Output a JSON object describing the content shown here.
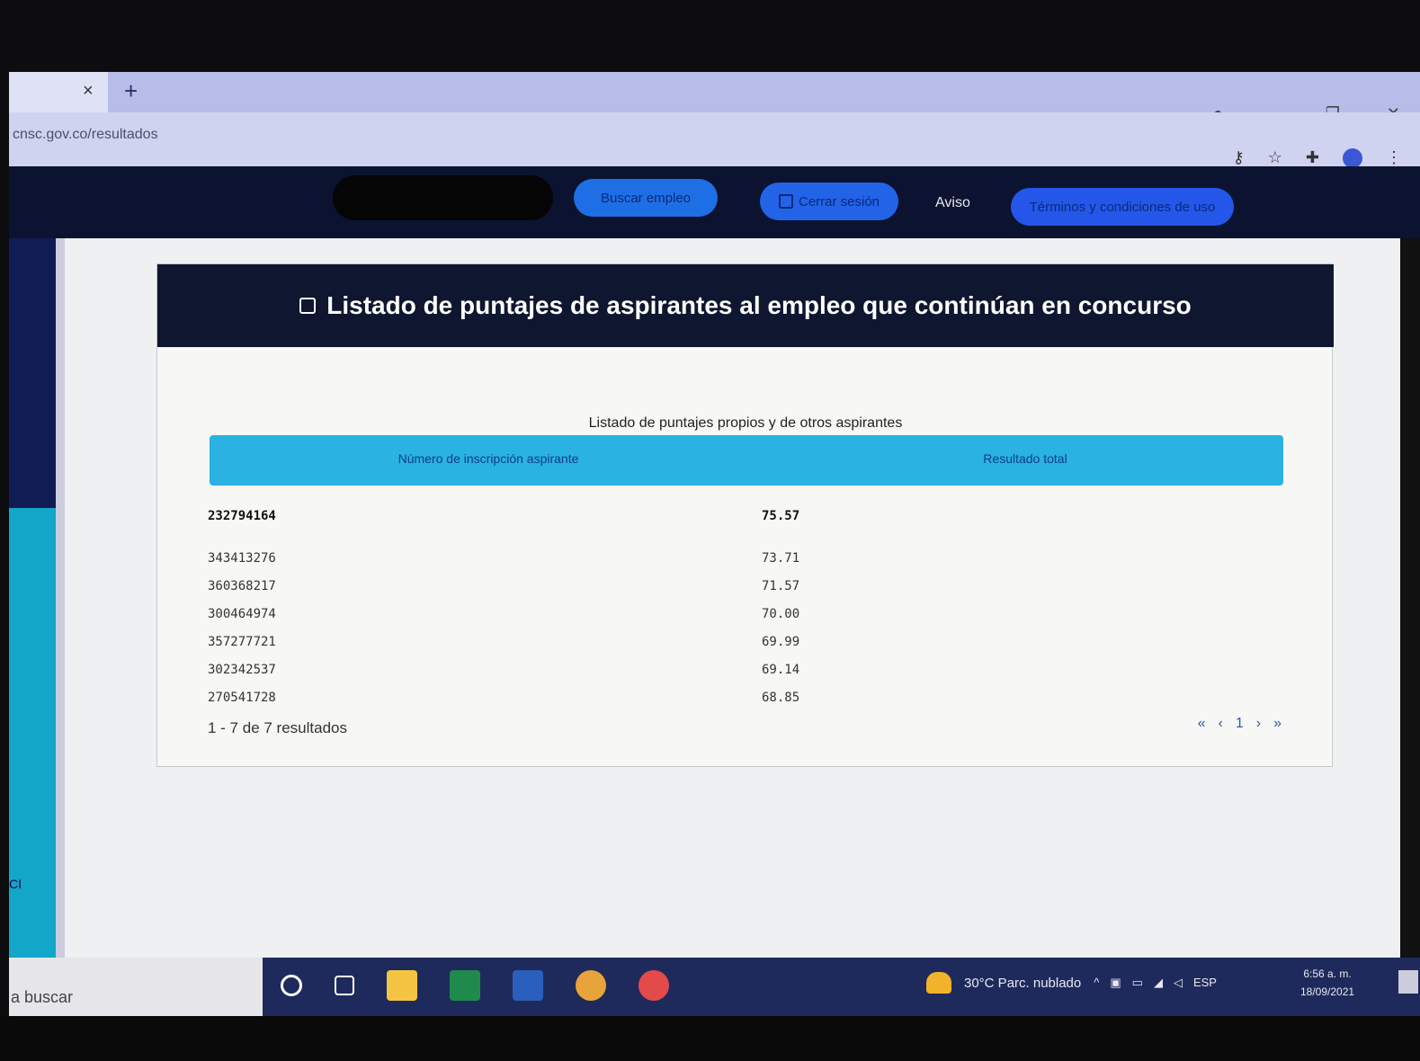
{
  "browser": {
    "url": "cnsc.gov.co/resultados",
    "tab_close": "×",
    "new_tab": "+"
  },
  "nav": {
    "buscar_empleo": "Buscar empleo",
    "cerrar_sesion": "Cerrar sesión",
    "aviso": "Aviso",
    "terminos": "Términos y condiciones de uso"
  },
  "page": {
    "title": "Listado de puntajes de aspirantes al empleo que continúan en concurso",
    "caption": "Listado de puntajes propios y de otros aspirantes",
    "columns": [
      "Número de inscripción aspirante",
      "Resultado total"
    ],
    "rows": [
      {
        "inscripcion": "232794164",
        "resultado": "75.57",
        "highlight": true
      },
      {
        "inscripcion": "343413276",
        "resultado": "73.71"
      },
      {
        "inscripcion": "360368217",
        "resultado": "71.57"
      },
      {
        "inscripcion": "300464974",
        "resultado": "70.00"
      },
      {
        "inscripcion": "357277721",
        "resultado": "69.99"
      },
      {
        "inscripcion": "302342537",
        "resultado": "69.14"
      },
      {
        "inscripcion": "270541728",
        "resultado": "68.85"
      }
    ],
    "results_summary": "1 - 7 de 7 resultados",
    "pager": {
      "first": "«",
      "prev": "‹",
      "current": "1",
      "next": "›",
      "last": "»"
    }
  },
  "sidebar": {
    "label": "CI"
  },
  "taskbar": {
    "search_placeholder": "a buscar",
    "weather": "30°C  Parc. nublado",
    "language": "ESP",
    "time": "6:56 a. m.",
    "date": "18/09/2021"
  },
  "colors": {
    "header_bg": "#0e1630",
    "table_header_bg": "#29b2e2",
    "nav_button": "#1e6fe6"
  }
}
